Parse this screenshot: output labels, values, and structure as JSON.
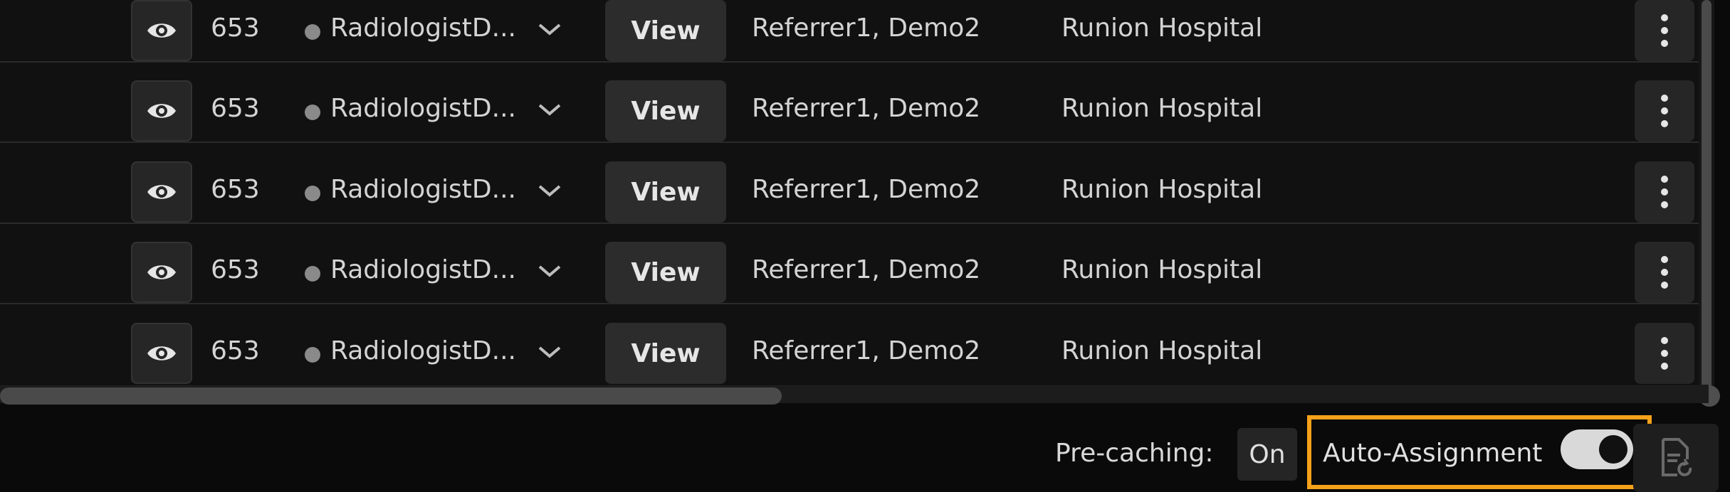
{
  "worklist": {
    "rows": [
      {
        "id": "653",
        "assignee": "RadiologistD...",
        "view_label": "View",
        "referrer": "Referrer1, Demo2",
        "hospital": "Runion Hospital"
      },
      {
        "id": "653",
        "assignee": "RadiologistD...",
        "view_label": "View",
        "referrer": "Referrer1, Demo2",
        "hospital": "Runion Hospital"
      },
      {
        "id": "653",
        "assignee": "RadiologistD...",
        "view_label": "View",
        "referrer": "Referrer1, Demo2",
        "hospital": "Runion Hospital"
      },
      {
        "id": "653",
        "assignee": "RadiologistD...",
        "view_label": "View",
        "referrer": "Referrer1, Demo2",
        "hospital": "Runion Hospital"
      },
      {
        "id": "653",
        "assignee": "RadiologistD...",
        "view_label": "View",
        "referrer": "Referrer1, Demo2",
        "hospital": "Runion Hospital"
      }
    ],
    "row_icons": {
      "preview": "eye-icon",
      "assignee_dropdown": "chevron-down-icon",
      "more": "more-vertical-icon"
    }
  },
  "footer": {
    "precaching_label": "Pre-caching:",
    "precaching_value": "On",
    "auto_assignment_label": "Auto-Assignment",
    "auto_assignment_enabled": true,
    "highlight_color": "#f5a11a",
    "doc_icon": "document-refresh-icon"
  }
}
